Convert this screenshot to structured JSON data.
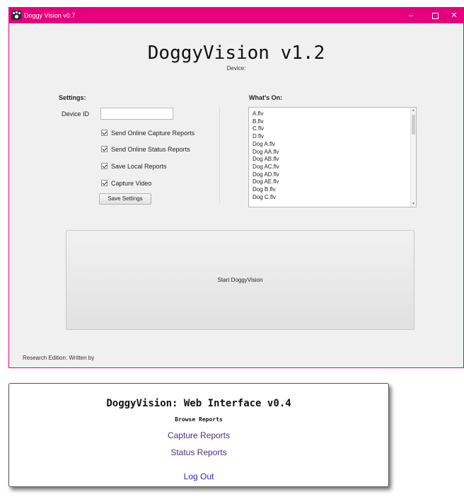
{
  "window": {
    "title": "Doggy Vision v0.7",
    "controls": {
      "minimize": "–",
      "maximize": "□",
      "close": "✕"
    }
  },
  "app": {
    "heading": "DoggyVision v1.2",
    "device_caption": "Device:"
  },
  "settings": {
    "title": "Settings:",
    "device_id_label": "Device ID",
    "device_id_value": "",
    "checkboxes": [
      {
        "label": "Send Online Capture Reports",
        "checked": true
      },
      {
        "label": "Send Online Status Reports",
        "checked": true
      },
      {
        "label": "Save Local Reports",
        "checked": true
      },
      {
        "label": "Capture Video",
        "checked": true
      }
    ],
    "save_button": "Save Settings"
  },
  "whats_on": {
    "title": "What's On:",
    "items": [
      "A.flv",
      "B.flv",
      "C.flv",
      "D.flv",
      "Dog A.flv",
      "Dog AA.flv",
      "Dog AB.flv",
      "Dog AC.flv",
      "Dog AD.flv",
      "Dog AE.flv",
      "Dog B.flv",
      "Dog C.flv"
    ]
  },
  "start_button": "Start DoggyVision",
  "footer": "Research Edition: Written by",
  "web": {
    "title": "DoggyVision: Web Interface v0.4",
    "subtitle": "Browse Reports",
    "links": {
      "capture": "Capture Reports",
      "status": "Status Reports",
      "logout": "Log Out"
    }
  },
  "colors": {
    "titlebar": "#e6007e",
    "link": "#4b2e7f",
    "logout_link": "#2c2cb8"
  }
}
